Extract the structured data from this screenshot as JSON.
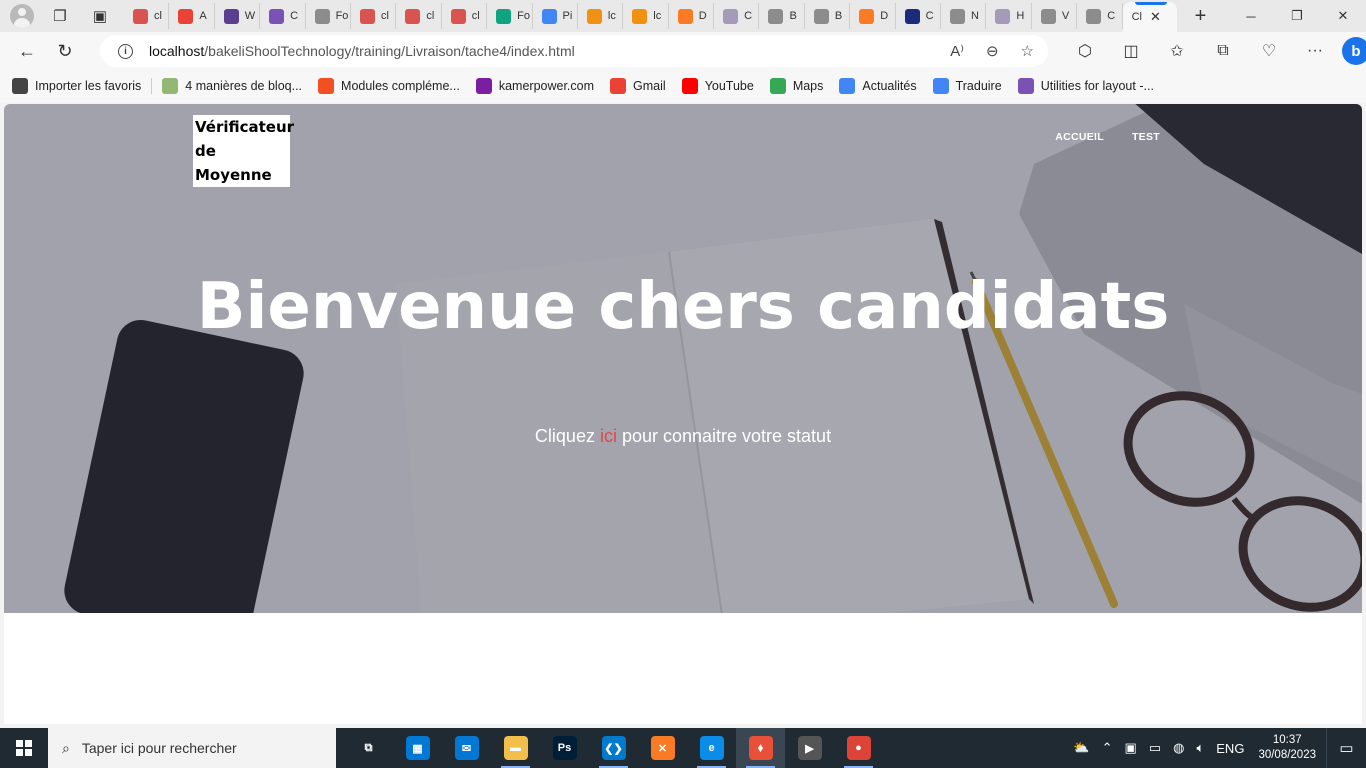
{
  "browser": {
    "tabs": [
      {
        "label": "cl",
        "icon": "pdf-icon",
        "color": "#d9534f"
      },
      {
        "label": "A",
        "icon": "gmail-icon",
        "color": "#ea4335"
      },
      {
        "label": "W",
        "icon": "colorlib-icon",
        "color": "#5b3e8f"
      },
      {
        "label": "C",
        "icon": "bootstrap-icon",
        "color": "#7952b3"
      },
      {
        "label": "Fo",
        "icon": "page-icon",
        "color": "#8c8c8c"
      },
      {
        "label": "cl",
        "icon": "pdf-icon",
        "color": "#d9534f"
      },
      {
        "label": "cl",
        "icon": "pdf-icon",
        "color": "#d9534f"
      },
      {
        "label": "cl",
        "icon": "pdf-icon",
        "color": "#d9534f"
      },
      {
        "label": "Fo",
        "icon": "openai-icon",
        "color": "#10a37f"
      },
      {
        "label": "Pi",
        "icon": "google-icon",
        "color": "#4285f4"
      },
      {
        "label": "lc",
        "icon": "phpmyadmin-icon",
        "color": "#f29111"
      },
      {
        "label": "lc",
        "icon": "phpmyadmin-icon",
        "color": "#f29111"
      },
      {
        "label": "D",
        "icon": "xampp-icon",
        "color": "#fb7a24"
      },
      {
        "label": "C",
        "icon": "bootstrap-icon",
        "color": "#a59bb8"
      },
      {
        "label": "B",
        "icon": "page-icon",
        "color": "#8c8c8c"
      },
      {
        "label": "B",
        "icon": "page-icon",
        "color": "#8c8c8c"
      },
      {
        "label": "D",
        "icon": "xampp-icon",
        "color": "#fb7a24"
      },
      {
        "label": "C",
        "icon": "w3-icon",
        "color": "#1b2c7a"
      },
      {
        "label": "N",
        "icon": "reader-icon",
        "color": "#8c8c8c"
      },
      {
        "label": "H",
        "icon": "bootstrap-icon",
        "color": "#a59bb8"
      },
      {
        "label": "V",
        "icon": "page-icon",
        "color": "#8c8c8c"
      },
      {
        "label": "C",
        "icon": "globe-icon",
        "color": "#8c8c8c"
      }
    ],
    "active_tab": {
      "label": "Cl"
    },
    "address": {
      "host": "localhost",
      "path": "/bakeliShoolTechnology/training/Livraison/tache4/index.html"
    },
    "favorites": [
      {
        "label": "Importer les favoris",
        "icon": "import-icon",
        "color": "#444444"
      },
      {
        "label": "4 manières de bloq...",
        "icon": "wikihow-icon",
        "color": "#93b874"
      },
      {
        "label": "Modules compléme...",
        "icon": "microsoft-icon",
        "color": "#f25022"
      },
      {
        "label": "kamerpower.com",
        "icon": "kamerpower-icon",
        "color": "#7b1fa2"
      },
      {
        "label": "Gmail",
        "icon": "gmail-icon",
        "color": "#ea4335"
      },
      {
        "label": "YouTube",
        "icon": "youtube-icon",
        "color": "#ff0000"
      },
      {
        "label": "Maps",
        "icon": "maps-icon",
        "color": "#34a853"
      },
      {
        "label": "Actualités",
        "icon": "news-icon",
        "color": "#4285f4"
      },
      {
        "label": "Traduire",
        "icon": "translate-icon",
        "color": "#4285f4"
      },
      {
        "label": "Utilities for layout -...",
        "icon": "bootstrap-icon",
        "color": "#7952b3"
      }
    ]
  },
  "page": {
    "brand": "Vérificateur de Moyenne",
    "nav": [
      {
        "label": "ACCUEIL"
      },
      {
        "label": "TEST"
      }
    ],
    "hero_title": "Bienvenue chers candidats",
    "hero_sub_before": "Cliquez ",
    "hero_sub_link": "ici",
    "hero_sub_after": " pour connaitre votre statut",
    "link_color": "#e04848"
  },
  "taskbar": {
    "search_placeholder": "Taper ici pour rechercher",
    "apps": [
      {
        "name": "task-view-icon",
        "color": "#1f2a33",
        "glyph": "⧉"
      },
      {
        "name": "store-icon",
        "color": "#0078d4",
        "glyph": "▦"
      },
      {
        "name": "mail-icon",
        "color": "#0078d4",
        "glyph": "✉"
      },
      {
        "name": "file-explorer-icon",
        "color": "#f2c04a",
        "glyph": "▬"
      },
      {
        "name": "photoshop-icon",
        "color": "#001e36",
        "glyph": "Ps"
      },
      {
        "name": "vscode-icon",
        "color": "#007acc",
        "glyph": "❮❯"
      },
      {
        "name": "xampp-icon",
        "color": "#fb7a24",
        "glyph": "✕"
      },
      {
        "name": "edge-icon",
        "color": "#0c8ce9",
        "glyph": "e"
      },
      {
        "name": "git-icon",
        "color": "#e8503a",
        "glyph": "⬧"
      },
      {
        "name": "media-player-icon",
        "color": "#555555",
        "glyph": "▶"
      },
      {
        "name": "chrome-icon",
        "color": "#db4437",
        "glyph": "●"
      }
    ],
    "language": "ENG",
    "time": "10:37",
    "date": "30/08/2023"
  }
}
